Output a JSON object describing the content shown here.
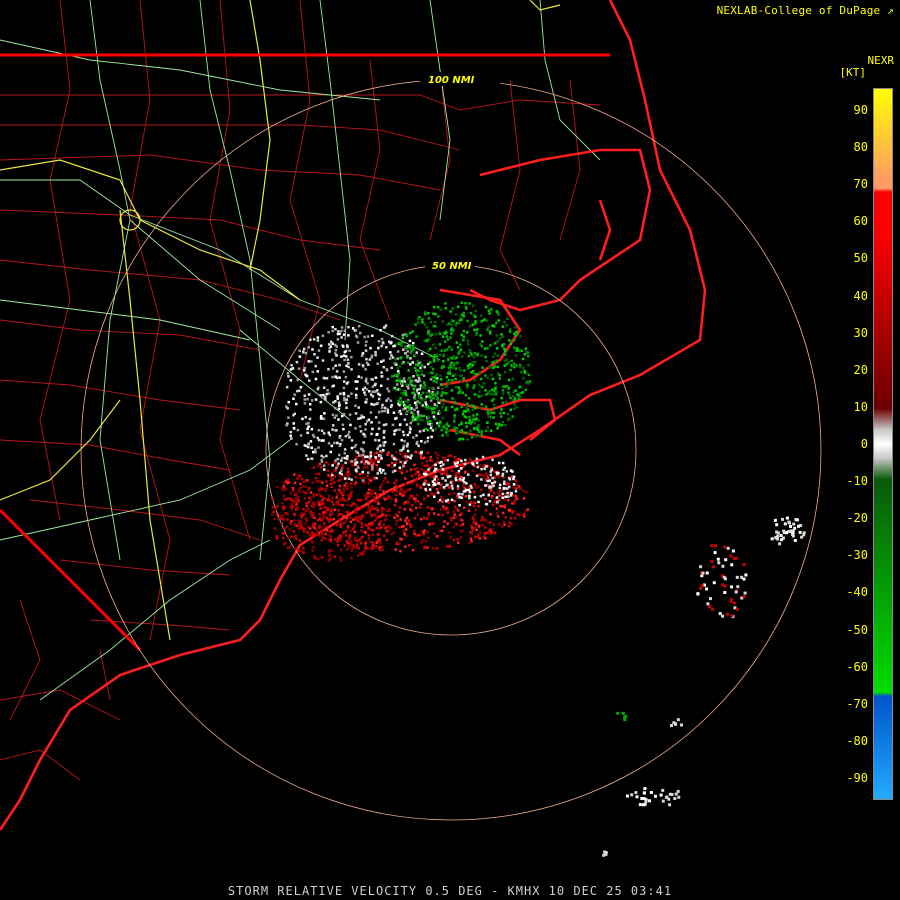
{
  "header": {
    "credit": "NEXLAB-College of DuPage",
    "credit_icon": "external-link-arrow-icon",
    "product": "NEXR",
    "unit": "[KT]"
  },
  "rings": [
    {
      "label": "100 NMI"
    },
    {
      "label": "50 NMI"
    }
  ],
  "scale": {
    "ticks": [
      "90",
      "80",
      "70",
      "60",
      "50",
      "40",
      "30",
      "20",
      "10",
      "0",
      "-10",
      "-20",
      "-30",
      "-40",
      "-50",
      "-60",
      "-70",
      "-80",
      "-90"
    ],
    "colors": {
      "yellow": "#ffff00",
      "orange": "#ff9966",
      "red": "#ff0000",
      "darkred": "#6b0000",
      "gray": "#c8c8c8",
      "darkgreen": "#0a5a0a",
      "green": "#00dd00",
      "blue": "#0055cc",
      "lightblue": "#22aaff"
    }
  },
  "footer": {
    "text": "STORM RELATIVE VELOCITY 0.5 DEG - KMHX 10 DEC 25 03:41"
  },
  "map_colors": {
    "county": "#b8171b",
    "state": "#ff0000",
    "coast": "#ff1e1e",
    "highway": "#9eea9e",
    "interstate": "#e8e83a",
    "ring": "#f0b090",
    "inbound": "#00aa00",
    "outbound": "#cc0000",
    "nearzero": "#d8d8d8"
  }
}
